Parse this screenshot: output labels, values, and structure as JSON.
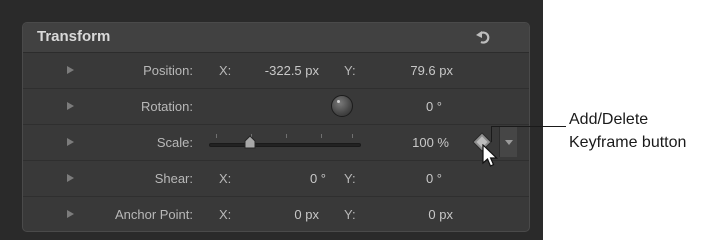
{
  "panel": {
    "title": "Transform",
    "reset_icon": "reset-arrow-icon"
  },
  "rows": {
    "position": {
      "label": "Position:",
      "x_label": "X:",
      "x_value": "-322.5 px",
      "y_label": "Y:",
      "y_value": "79.6 px"
    },
    "rotation": {
      "label": "Rotation:",
      "value": "0 °"
    },
    "scale": {
      "label": "Scale:",
      "value": "100 %",
      "slider_fraction": 0.25
    },
    "shear": {
      "label": "Shear:",
      "x_label": "X:",
      "x_value": "0 °",
      "y_label": "Y:",
      "y_value": "0 °"
    },
    "anchor_point": {
      "label": "Anchor Point:",
      "x_label": "X:",
      "x_value": "0 px",
      "y_label": "Y:",
      "y_value": "0 px"
    }
  },
  "keyframe": {
    "icon": "diamond-keyframe-icon",
    "menu_icon": "chevron-down-icon"
  },
  "callout": {
    "line1": "Add/Delete",
    "line2": "Keyframe button"
  },
  "colors": {
    "panel_bg": "#393939",
    "header_bg": "#414141",
    "text": "#b8b8b8"
  }
}
